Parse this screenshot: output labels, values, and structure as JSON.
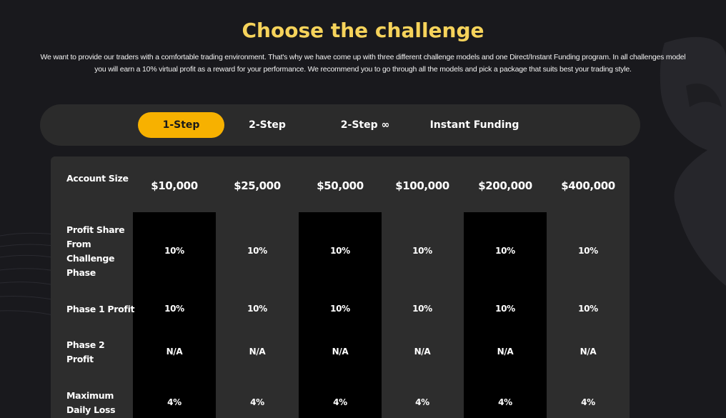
{
  "header": {
    "title": "Choose the challenge",
    "intro": "We want to provide our traders with a comfortable trading environment. That's why we have come up with three different challenge models and one Direct/Instant Funding program. In all challenges model you will earn a 10% virtual profit as a reward for your performance. We recommend you to go through all the models and pick a package that suits best your trading style."
  },
  "tabs": [
    {
      "label": "1-Step",
      "active": true
    },
    {
      "label": "2-Step",
      "active": false
    },
    {
      "label": "2-Step ∞",
      "active": false
    },
    {
      "label": "Instant Funding",
      "active": false
    }
  ],
  "table": {
    "account_size_label": "Account Size",
    "columns": [
      "$10,000",
      "$25,000",
      "$50,000",
      "$100,000",
      "$200,000",
      "$400,000"
    ],
    "rows": [
      {
        "label": "Profit Share From Challenge Phase",
        "values": [
          "10%",
          "10%",
          "10%",
          "10%",
          "10%",
          "10%"
        ]
      },
      {
        "label": "Phase 1 Profit",
        "values": [
          "10%",
          "10%",
          "10%",
          "10%",
          "10%",
          "10%"
        ]
      },
      {
        "label": "Phase 2 Profit",
        "values": [
          "N/A",
          "N/A",
          "N/A",
          "N/A",
          "N/A",
          "N/A"
        ]
      },
      {
        "label": "Maximum Daily Loss",
        "values": [
          "4%",
          "4%",
          "4%",
          "4%",
          "4%",
          "4%"
        ]
      }
    ]
  },
  "colors": {
    "accent": "#f7b100",
    "title": "#f6d35b",
    "background": "#19191d",
    "panel": "#2d2d2d"
  }
}
